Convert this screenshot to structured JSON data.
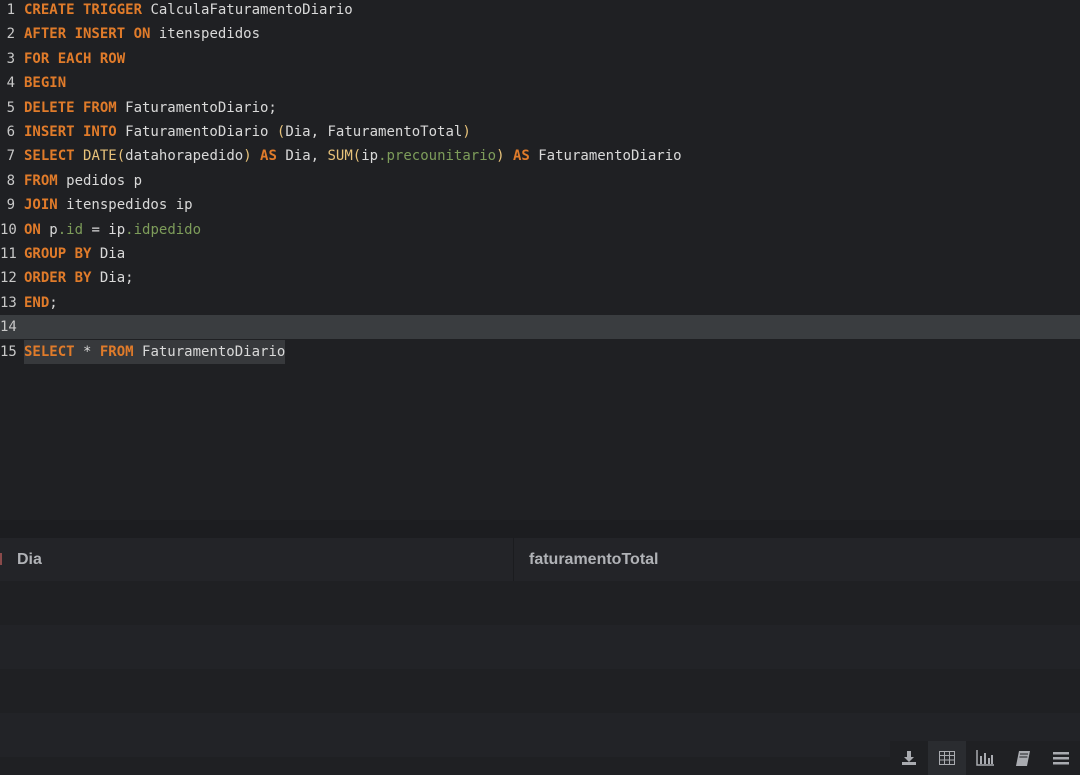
{
  "editor": {
    "lines": [
      {
        "number": "1",
        "tokens": [
          [
            "kw",
            "CREATE TRIGGER"
          ],
          [
            "id",
            " CalculaFaturamentoDiario"
          ]
        ]
      },
      {
        "number": "2",
        "tokens": [
          [
            "kw",
            "AFTER INSERT ON"
          ],
          [
            "id",
            " itenspedidos"
          ]
        ]
      },
      {
        "number": "3",
        "tokens": [
          [
            "kw",
            "FOR EACH ROW"
          ]
        ]
      },
      {
        "number": "4",
        "tokens": [
          [
            "kw",
            "BEGIN"
          ]
        ]
      },
      {
        "number": "5",
        "tokens": [
          [
            "kw",
            "DELETE FROM"
          ],
          [
            "id",
            " FaturamentoDiario;"
          ]
        ]
      },
      {
        "number": "6",
        "tokens": [
          [
            "kw",
            "INSERT INTO"
          ],
          [
            "id",
            " FaturamentoDiario "
          ],
          [
            "fn",
            "("
          ],
          [
            "id",
            "Dia, FaturamentoTotal"
          ],
          [
            "fn",
            ")"
          ]
        ]
      },
      {
        "number": "7",
        "tokens": [
          [
            "kw",
            "SELECT "
          ],
          [
            "fn",
            "DATE("
          ],
          [
            "id",
            "datahorapedido"
          ],
          [
            "fn",
            ")"
          ],
          [
            "kw",
            " AS"
          ],
          [
            "id",
            " Dia, "
          ],
          [
            "fn",
            "SUM("
          ],
          [
            "id",
            "ip"
          ],
          [
            "col",
            ".precounitario"
          ],
          [
            "fn",
            ")"
          ],
          [
            "kw",
            " AS"
          ],
          [
            "id",
            " FaturamentoDiario"
          ]
        ]
      },
      {
        "number": "8",
        "tokens": [
          [
            "kw",
            "FROM"
          ],
          [
            "id",
            " pedidos p"
          ]
        ]
      },
      {
        "number": "9",
        "tokens": [
          [
            "kw",
            "JOIN"
          ],
          [
            "id",
            " itenspedidos ip"
          ]
        ]
      },
      {
        "number": "10",
        "tokens": [
          [
            "kw",
            "ON"
          ],
          [
            "id",
            " p"
          ],
          [
            "col",
            ".id"
          ],
          [
            "id",
            " = ip"
          ],
          [
            "col",
            ".idpedido"
          ]
        ]
      },
      {
        "number": "11",
        "tokens": [
          [
            "kw",
            "GROUP BY"
          ],
          [
            "id",
            " Dia"
          ]
        ]
      },
      {
        "number": "12",
        "tokens": [
          [
            "kw",
            "ORDER BY"
          ],
          [
            "id",
            " Dia;"
          ]
        ]
      },
      {
        "number": "13",
        "tokens": [
          [
            "kw",
            "END"
          ],
          [
            "id",
            ";"
          ]
        ]
      },
      {
        "number": "14",
        "tokens": [],
        "current": true
      },
      {
        "number": "15",
        "tokens": [
          [
            "kw",
            "SELECT"
          ],
          [
            "id",
            " * "
          ],
          [
            "kw",
            "FROM"
          ],
          [
            "id",
            " FaturamentoDiario"
          ]
        ],
        "selected": true
      }
    ]
  },
  "results": {
    "columns": [
      "Dia",
      "faturamentoTotal"
    ],
    "rows": 4
  },
  "toolbar": {
    "buttons": [
      {
        "name": "download-icon",
        "active": false
      },
      {
        "name": "table-icon",
        "active": true
      },
      {
        "name": "bar-chart-icon",
        "active": false
      },
      {
        "name": "notebook-icon",
        "active": false
      },
      {
        "name": "menu-icon",
        "active": false
      }
    ]
  },
  "colors": {
    "keyword": "#e07b2a",
    "function": "#e7c27a",
    "column": "#7d9c5a",
    "text": "#d9d9d9",
    "background": "#1f2023"
  }
}
